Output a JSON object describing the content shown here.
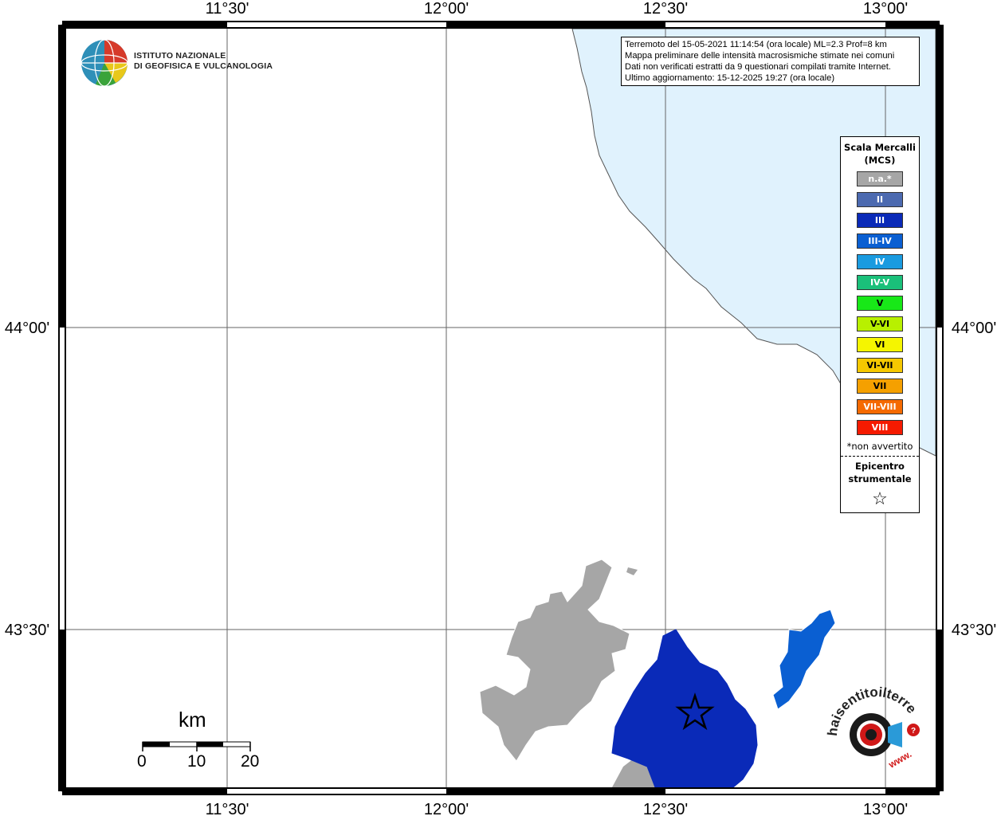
{
  "info": {
    "line1": "Terremoto del 15-05-2021 11:14:54 (ora locale) ML=2.3 Prof=8 km",
    "line2": "Mappa preliminare delle intensità macrosismiche stimate nei comuni",
    "line3": "Dati non verificati estratti da 9 questionari compilati tramite Internet.",
    "line4": "Ultimo aggiornamento: 15-12-2025 19:27 (ora locale)"
  },
  "logo": {
    "line1": "ISTITUTO NAZIONALE",
    "line2": "DI GEOFISICA E VULCANOLOGIA"
  },
  "axes": {
    "lon_ticks": [
      "11°30'",
      "12°00'",
      "12°30'",
      "13°00'"
    ],
    "lat_ticks": [
      "44°00'",
      "43°30'"
    ]
  },
  "legend": {
    "title": "Scala Mercalli (MCS)",
    "items": [
      {
        "label": "n.a.*",
        "color": "#a6a6a6"
      },
      {
        "label": "II",
        "color": "#4c6ab0"
      },
      {
        "label": "III",
        "color": "#0a2ab8"
      },
      {
        "label": "III-IV",
        "color": "#0a5fd2"
      },
      {
        "label": "IV",
        "color": "#1a9be0"
      },
      {
        "label": "IV-V",
        "color": "#1ac07a"
      },
      {
        "label": "V",
        "color": "#18e818"
      },
      {
        "label": "V-VI",
        "color": "#b8f000"
      },
      {
        "label": "VI",
        "color": "#f5f500"
      },
      {
        "label": "VI-VII",
        "color": "#f5c800"
      },
      {
        "label": "VII",
        "color": "#f5a000"
      },
      {
        "label": "VII-VIII",
        "color": "#f56a00"
      },
      {
        "label": "VIII",
        "color": "#f51a00"
      }
    ],
    "note": "*non avvertito",
    "epicenter_label": "Epicentro strumentale",
    "epicenter_symbol": "☆"
  },
  "scalebar": {
    "unit": "km",
    "labels": [
      "0",
      "10",
      "20"
    ]
  },
  "website_logo": {
    "text": "haisentitoilterremoto.it",
    "url_text": "www."
  },
  "colors": {
    "sea": "#e0f2fd",
    "not_felt": "#a6a6a6",
    "intensity_III": "#0a2ab8",
    "intensity_III_IV": "#0a5fd2"
  }
}
